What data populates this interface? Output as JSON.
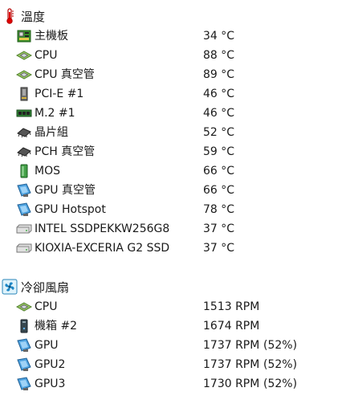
{
  "temperatures": {
    "title": "溫度",
    "header_icon": "thermometer-icon",
    "rows": [
      {
        "label": "主機板",
        "value": "34 °C",
        "icon": "motherboard-icon"
      },
      {
        "label": "CPU",
        "value": "88 °C",
        "icon": "cpu-chip-icon"
      },
      {
        "label": "CPU 真空管",
        "value": "89 °C",
        "icon": "cpu-chip-icon"
      },
      {
        "label": "PCI-E #1",
        "value": "46 °C",
        "icon": "pcie-card-icon"
      },
      {
        "label": "M.2 #1",
        "value": "46 °C",
        "icon": "m2-ssd-icon"
      },
      {
        "label": "晶片組",
        "value": "52 °C",
        "icon": "chipset-icon"
      },
      {
        "label": "PCH 真空管",
        "value": "59 °C",
        "icon": "chipset-icon"
      },
      {
        "label": "MOS",
        "value": "66 °C",
        "icon": "mosfet-icon"
      },
      {
        "label": "GPU 真空管",
        "value": "66 °C",
        "icon": "gpu-icon"
      },
      {
        "label": "GPU Hotspot",
        "value": "78 °C",
        "icon": "gpu-icon"
      },
      {
        "label": "INTEL SSDPEKKW256G8",
        "value": "37 °C",
        "icon": "drive-icon"
      },
      {
        "label": "KIOXIA-EXCERIA G2 SSD",
        "value": "37 °C",
        "icon": "drive-icon"
      }
    ]
  },
  "fans": {
    "title": "冷卻風扇",
    "header_icon": "fan-icon",
    "rows": [
      {
        "label": "CPU",
        "value": "1513 RPM",
        "pct": "",
        "icon": "cpu-chip-icon"
      },
      {
        "label": "機箱 #2",
        "value": "1674 RPM",
        "pct": "",
        "icon": "case-icon"
      },
      {
        "label": "GPU",
        "value": "1737 RPM",
        "pct": "(52%)",
        "icon": "gpu-icon"
      },
      {
        "label": "GPU2",
        "value": "1737 RPM",
        "pct": "(52%)",
        "icon": "gpu-icon"
      },
      {
        "label": "GPU3",
        "value": "1730 RPM",
        "pct": "(52%)",
        "icon": "gpu-icon"
      }
    ]
  }
}
